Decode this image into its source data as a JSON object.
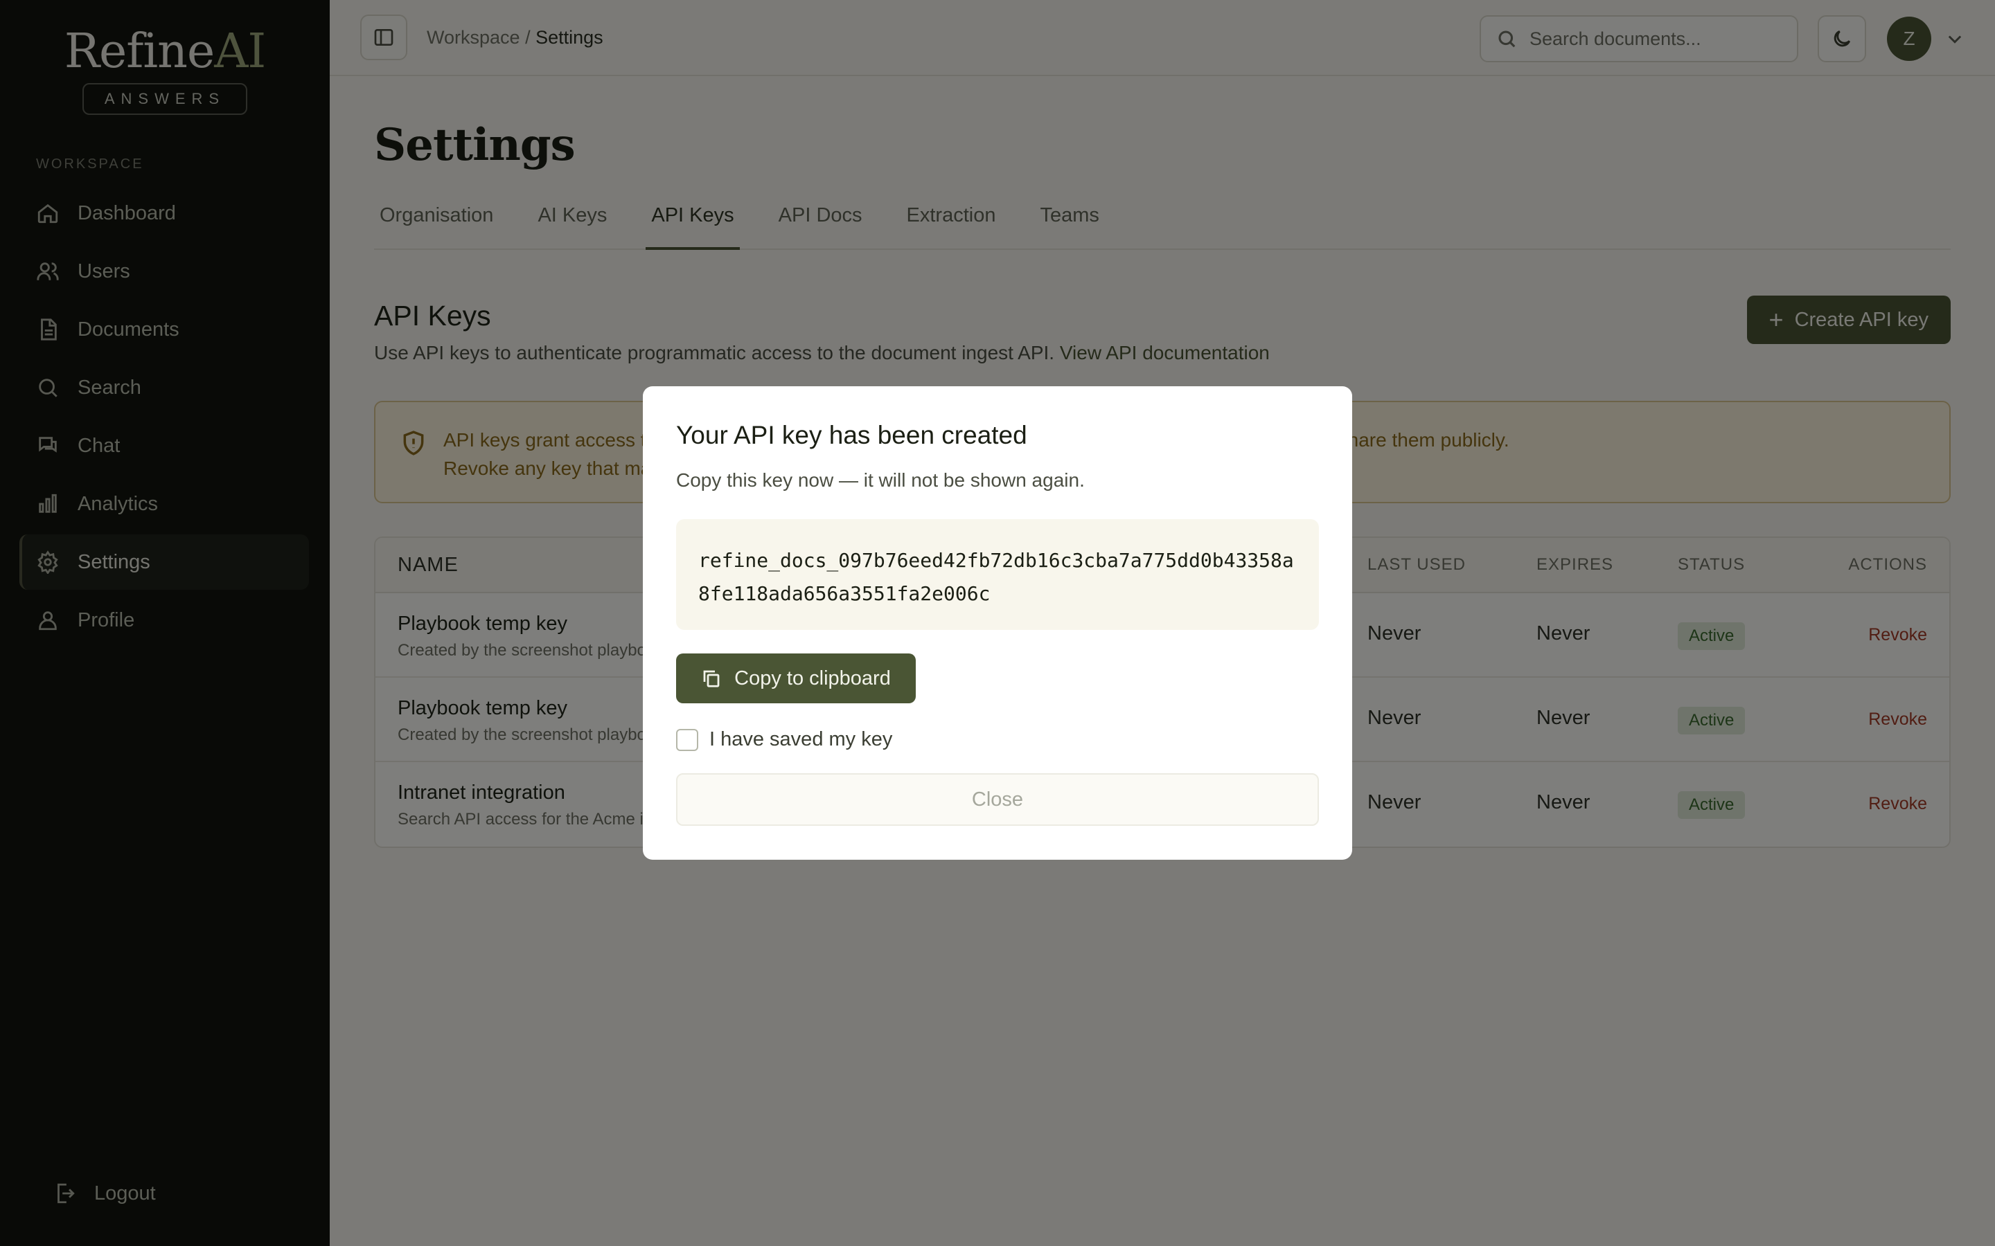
{
  "brand": {
    "name_main": "Refine",
    "name_accent": "AI",
    "tagline": "ANSWERS"
  },
  "sidebar": {
    "section_label": "WORKSPACE",
    "items": [
      {
        "label": "Dashboard",
        "icon": "home-icon"
      },
      {
        "label": "Users",
        "icon": "users-icon"
      },
      {
        "label": "Documents",
        "icon": "document-icon"
      },
      {
        "label": "Search",
        "icon": "search-icon"
      },
      {
        "label": "Chat",
        "icon": "chat-icon"
      },
      {
        "label": "Analytics",
        "icon": "bar-chart-icon"
      },
      {
        "label": "Settings",
        "icon": "gear-icon",
        "active": true
      },
      {
        "label": "Profile",
        "icon": "user-icon"
      }
    ],
    "logout_label": "Logout"
  },
  "topbar": {
    "breadcrumb_root": "Workspace",
    "breadcrumb_sep": "/",
    "breadcrumb_current": "Settings",
    "search_placeholder": "Search documents...",
    "avatar_initial": "Z"
  },
  "page": {
    "title": "Settings",
    "tabs": [
      "Organisation",
      "AI Keys",
      "API Keys",
      "API Docs",
      "Extraction",
      "Teams"
    ],
    "active_tab": "API Keys"
  },
  "api_keys": {
    "title": "API Keys",
    "description": "Use API keys to authenticate programmatic access to the document ingest API.",
    "doc_link": "View API documentation",
    "create_label": "Create API key",
    "warning_line1": "API keys grant access to your workspace. Keep them secret — do not commit them to source control or share them publicly.",
    "warning_line2": "Revoke any key that may have been exposed.",
    "columns": {
      "name": "NAME",
      "last_used": "LAST USED",
      "expires": "EXPIRES",
      "status": "STATUS",
      "actions": "ACTIONS"
    },
    "rows": [
      {
        "name": "Playbook temp key",
        "desc": "Created by the screenshot playbook",
        "last_used": "Never",
        "expires": "Never",
        "status": "Active",
        "action": "Revoke"
      },
      {
        "name": "Playbook temp key",
        "desc": "Created by the screenshot playbook",
        "last_used": "Never",
        "expires": "Never",
        "status": "Active",
        "action": "Revoke"
      },
      {
        "name": "Intranet integration",
        "desc": "Search API access for the Acme intranet",
        "last_used": "Never",
        "expires": "Never",
        "status": "Active",
        "action": "Revoke"
      }
    ]
  },
  "modal": {
    "title": "Your API key has been created",
    "description": "Copy this key now — it will not be shown again.",
    "key": "refine_docs_097b76eed42fb72db16c3cba7a775dd0b43358a8fe118ada656a3551fa2e006c",
    "copy_label": "Copy to clipboard",
    "checkbox_label": "I have saved my key",
    "checkbox_checked": false,
    "close_label": "Close"
  },
  "colors": {
    "accent": "#4a5534",
    "sidebar_bg": "#13150f",
    "danger": "#a33b26",
    "active_badge": "#dfe8d6"
  }
}
